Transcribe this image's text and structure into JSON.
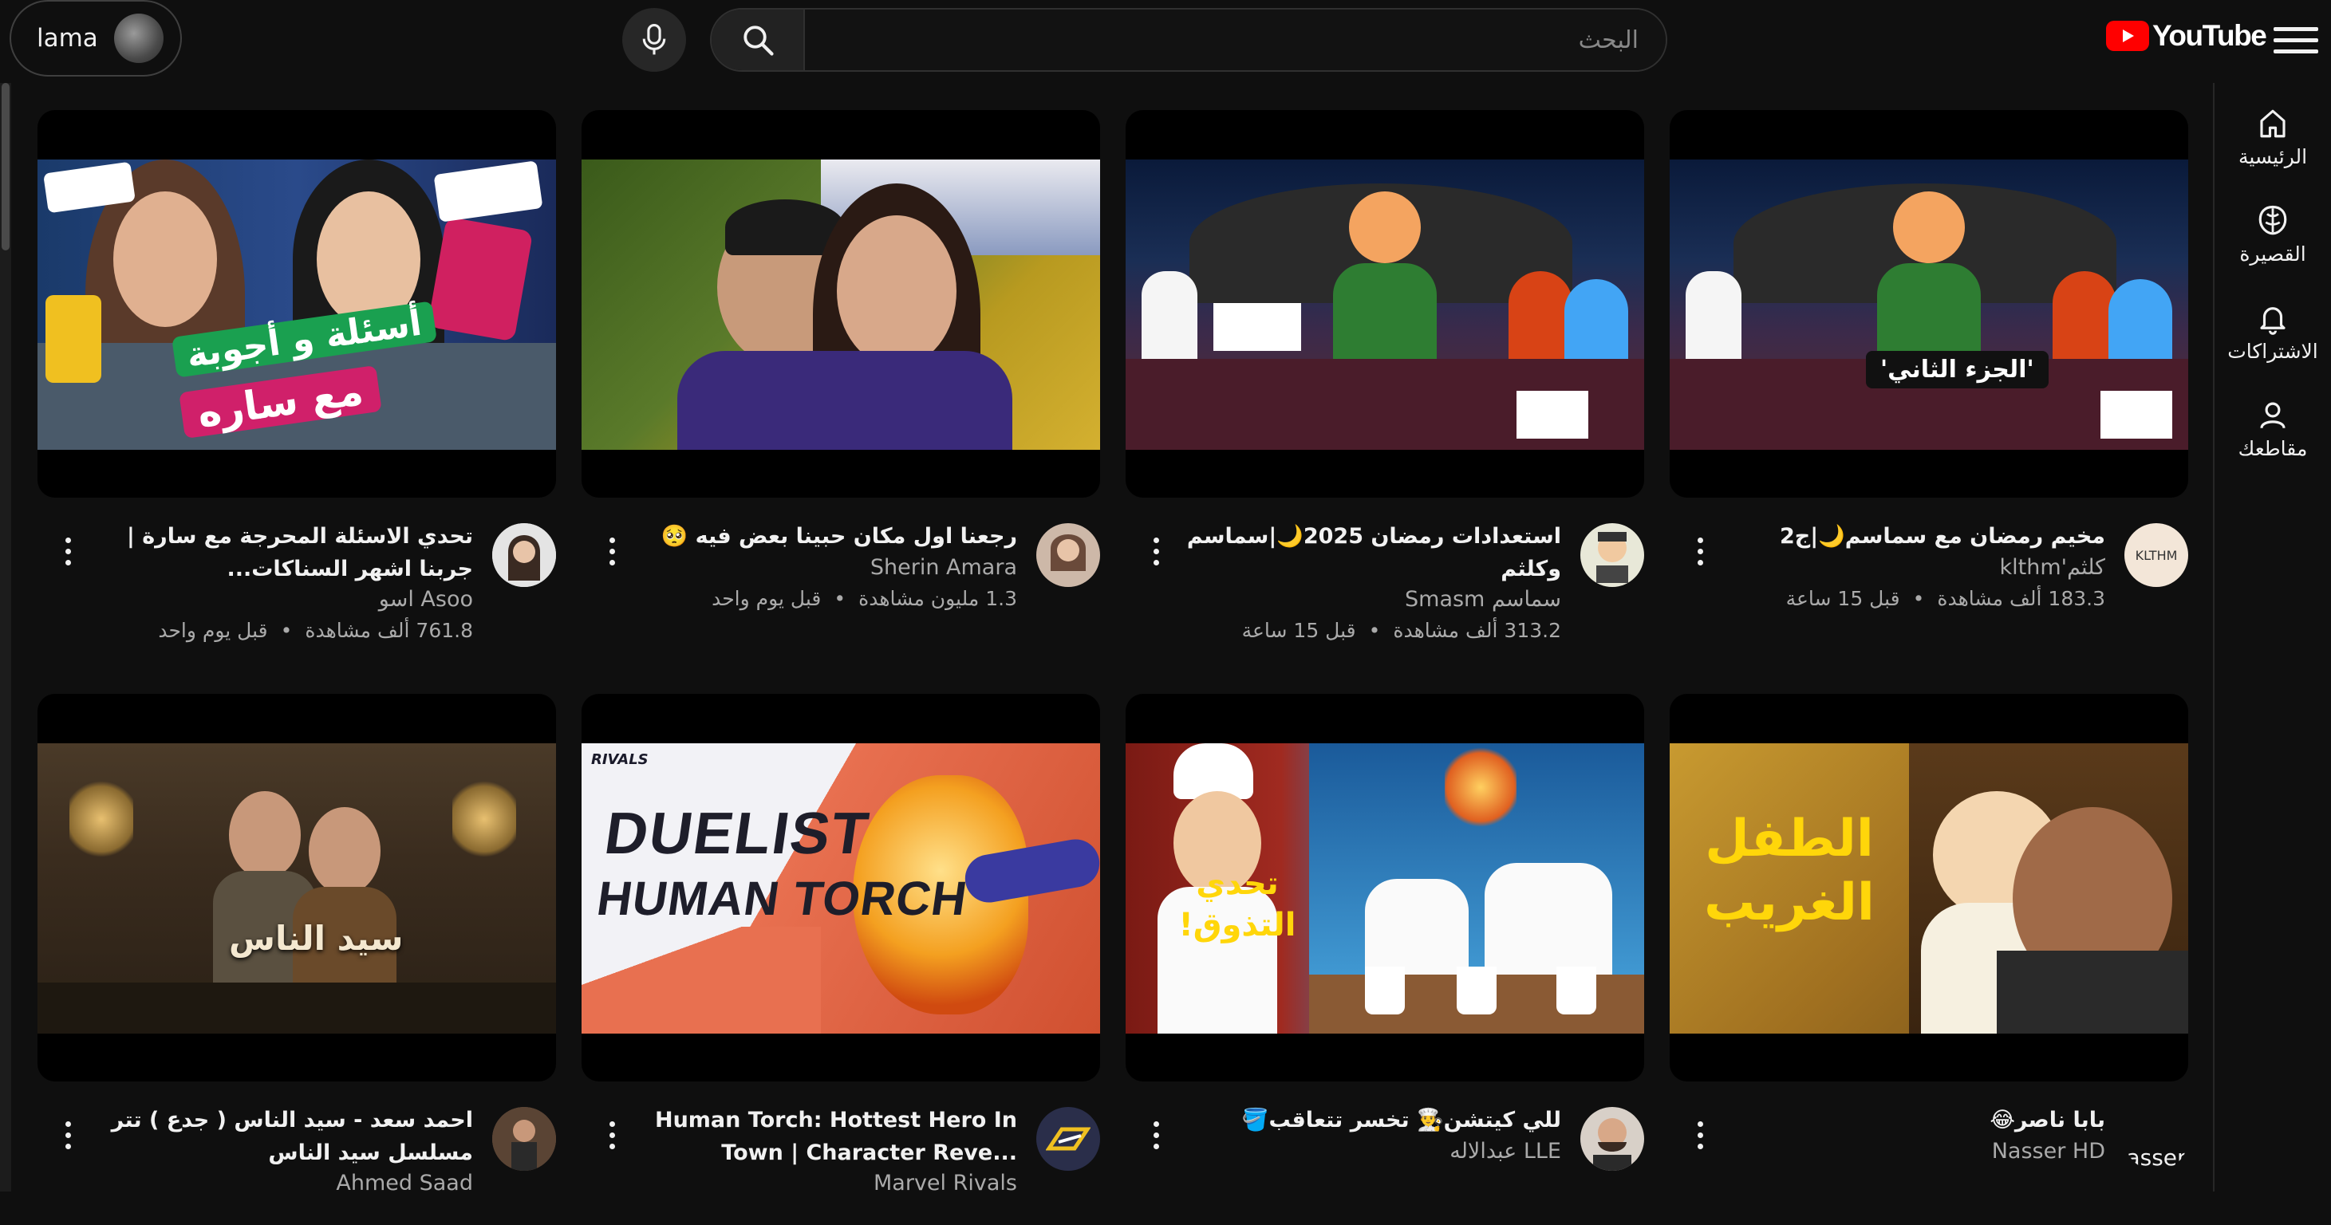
{
  "header": {
    "account_name": "lama",
    "search_placeholder": "البحث",
    "logo_text": "YouTube"
  },
  "guide": {
    "items": [
      {
        "label": "الرئيسية",
        "icon": "home-icon"
      },
      {
        "label": "القصيرة",
        "icon": "shorts-icon"
      },
      {
        "label": "الاشتراكات",
        "icon": "subscriptions-icon"
      },
      {
        "label": "مقاطعك",
        "icon": "you-icon"
      }
    ]
  },
  "videos": [
    {
      "title": "مخيم رمضان مع سماسم🌙|ج2",
      "channel": "كلثم'klthm",
      "views": "183.3 ألف مشاهدة",
      "age": "قبل 15 ساعة",
      "thumb_text": "'الجزء الثاني'"
    },
    {
      "title": "استعدادات رمضان 2025🌙|سماسم وكلثم",
      "channel": "سماسم Smasm",
      "views": "313.2 ألف مشاهدة",
      "age": "قبل 15 ساعة"
    },
    {
      "title": "رجعنا اول مكان حبينا بعض فيه 🥺",
      "channel": "Sherin Amara",
      "views": "1.3 مليون مشاهدة",
      "age": "قبل يوم واحد"
    },
    {
      "title": "تحدي الاسئلة المحرجة مع سارة | جربنا اشهر السناكات...",
      "channel": "Asoo اسو",
      "views": "761.8 ألف مشاهدة",
      "age": "قبل يوم واحد",
      "thumb_text_1": "أسئلة و أجوبة",
      "thumb_text_2": "مع ساره"
    },
    {
      "title": "بابا ناصر😂",
      "channel": "Nasser HD",
      "avatar_text": "asser",
      "thumb_text": "الطفل الغريب"
    },
    {
      "title": "للي كيتشن👨‍🍳 تخسر تتعاقب🪣",
      "channel": "LLE عبدالاله",
      "thumb_text": "تحدي التذوق!"
    },
    {
      "title": "Human Torch: Hottest Hero In Town | Character Reve...",
      "channel": "Marvel Rivals",
      "thumb_text_1": "DUELIST",
      "thumb_text_2": "HUMAN TORCH",
      "thumb_badge": "RIVALS"
    },
    {
      "title": "احمد سعد - سيد الناس ( جدع ) تتر مسلسل سيد الناس",
      "channel": "Ahmed Saad",
      "thumb_text": "سيد الناس"
    }
  ],
  "colors": {
    "background": "#0f0f0f",
    "brand_red": "#ff0000",
    "secondary_text": "#aaaaaa"
  }
}
